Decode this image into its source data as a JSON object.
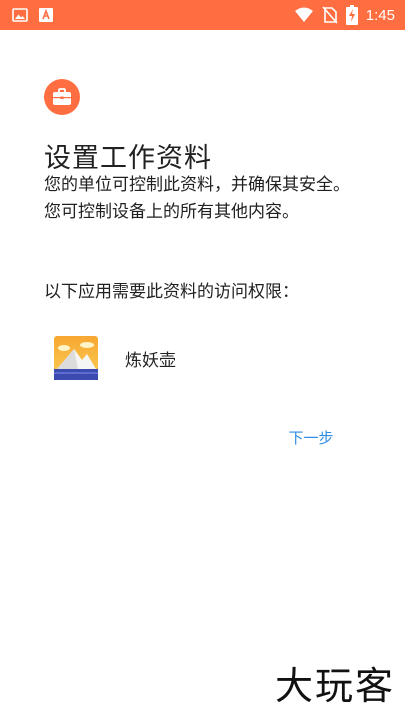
{
  "status_bar": {
    "time": "1:45",
    "left_icons": [
      "image-icon",
      "text-icon"
    ],
    "right_icons": [
      "wifi-icon",
      "no-sim-icon",
      "battery-charging-icon"
    ]
  },
  "setup": {
    "title": "设置工作资料",
    "description": "您的单位可控制此资料，并确保其安全。您可控制设备上的所有其他内容。",
    "permission_label": "以下应用需要此资料的访问权限：",
    "app_name": "炼妖壶",
    "next_label": "下一步"
  },
  "watermark": "大玩客",
  "colors": {
    "accent": "#ff6e40",
    "link": "#2f8de4"
  }
}
